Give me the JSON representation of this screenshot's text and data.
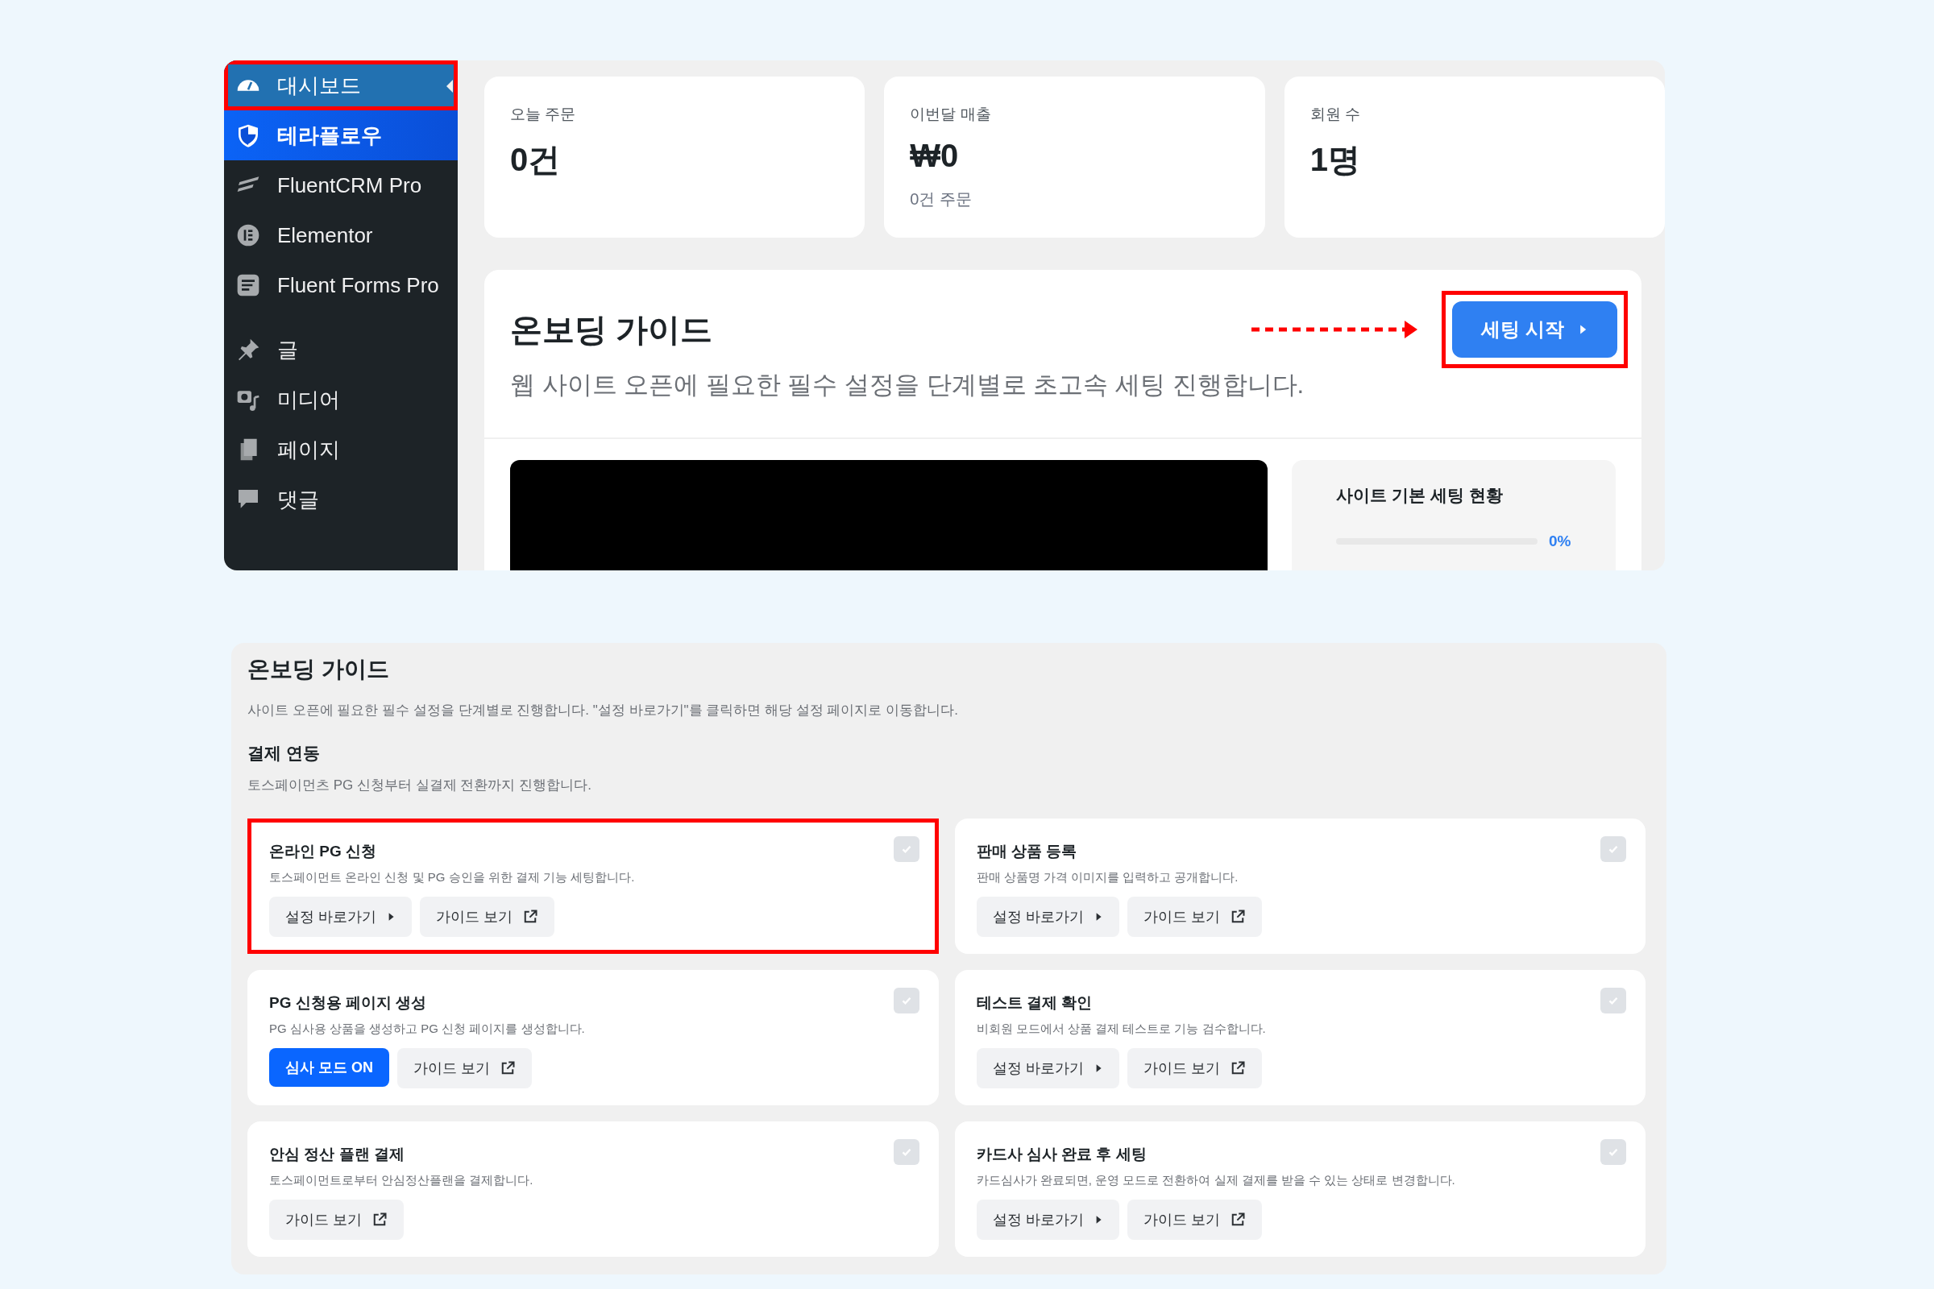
{
  "sidebar": {
    "groups": [
      {
        "items": [
          {
            "label": "대시보드",
            "kind": "current",
            "selected": true,
            "highlighted": true
          },
          {
            "label": "테라플로우",
            "kind": "brand",
            "selected": false,
            "highlighted": false
          },
          {
            "label": "FluentCRM Pro",
            "kind": "plain",
            "selected": false,
            "highlighted": false
          },
          {
            "label": "Elementor",
            "kind": "plain",
            "selected": false,
            "highlighted": false
          },
          {
            "label": "Fluent Forms Pro",
            "kind": "plain",
            "selected": false,
            "highlighted": false
          }
        ]
      },
      {
        "items": [
          {
            "label": "글",
            "kind": "plain",
            "selected": false,
            "highlighted": false
          },
          {
            "label": "미디어",
            "kind": "plain",
            "selected": false,
            "highlighted": false
          },
          {
            "label": "페이지",
            "kind": "plain",
            "selected": false,
            "highlighted": false
          },
          {
            "label": "댓글",
            "kind": "plain",
            "selected": false,
            "highlighted": false
          }
        ]
      }
    ]
  },
  "stats": [
    {
      "label": "오늘 주문",
      "value": "0건"
    },
    {
      "label": "이번달 매출",
      "value": "₩0",
      "note": "0건 주문"
    },
    {
      "label": "회원 수",
      "value": "1명"
    }
  ],
  "onboarding": {
    "title": "온보딩 가이드",
    "subtitle": "웹 사이트 오픈에 필요한 필수 설정을 단계별로 초고속 세팅 진행합니다.",
    "start_button": {
      "label": "세팅 시작",
      "highlighted": true
    },
    "status_panel": {
      "title": "사이트 기본 세팅 현황",
      "level": 0,
      "reading": "0%"
    }
  },
  "guide": {
    "title": "온보딩 가이드",
    "description": "사이트 오픈에 필요한 필수 설정을 단계별로 진행합니다. \"설정 바로가기\"를 클릭하면 해당 설정 페이지로 이동합니다.",
    "section": {
      "title": "결제 연동",
      "description": "토스페이먼츠 PG 신청부터 실결제 전환까지 진행합니다."
    },
    "steps": [
      {
        "title": "온라인 PG 신청",
        "description": "토스페이먼트 온라인 신청 및 PG 승인을 위한 결제 기능 세팅합니다.",
        "checked": false,
        "highlighted": true,
        "buttons": [
          {
            "kind": "settings",
            "label": "설정 바로가기"
          },
          {
            "kind": "guide",
            "label": "가이드 보기"
          }
        ]
      },
      {
        "title": "판매 상품 등록",
        "description": "판매 상품명 가격 이미지를 입력하고 공개합니다.",
        "checked": false,
        "highlighted": false,
        "buttons": [
          {
            "kind": "settings",
            "label": "설정 바로가기"
          },
          {
            "kind": "guide",
            "label": "가이드 보기"
          }
        ]
      },
      {
        "title": "PG 신청용 페이지 생성",
        "description": "PG 심사용 상품을 생성하고 PG 신청 페이지를 생성합니다.",
        "checked": false,
        "highlighted": false,
        "buttons": [
          {
            "kind": "primary",
            "label": "심사 모드 ON"
          },
          {
            "kind": "guide",
            "label": "가이드 보기"
          }
        ]
      },
      {
        "title": "테스트 결제 확인",
        "description": "비회원 모드에서 상품 결제 테스트로 기능 검수합니다.",
        "checked": false,
        "highlighted": false,
        "buttons": [
          {
            "kind": "settings",
            "label": "설정 바로가기"
          },
          {
            "kind": "guide",
            "label": "가이드 보기"
          }
        ]
      },
      {
        "title": "안심 정산 플랜 결제",
        "description": "토스페이먼트로부터 안심정산플랜을 결제합니다.",
        "checked": false,
        "highlighted": false,
        "buttons": [
          {
            "kind": "guide",
            "label": "가이드 보기"
          }
        ]
      },
      {
        "title": "카드사 심사 완료 후 세팅",
        "description": "카드심사가 완료되면, 운영 모드로 전환하여 실제 결제를 받을 수 있는 상태로 변경합니다.",
        "checked": false,
        "highlighted": false,
        "buttons": [
          {
            "kind": "settings",
            "label": "설정 바로가기"
          },
          {
            "kind": "guide",
            "label": "가이드 보기"
          }
        ]
      }
    ]
  }
}
